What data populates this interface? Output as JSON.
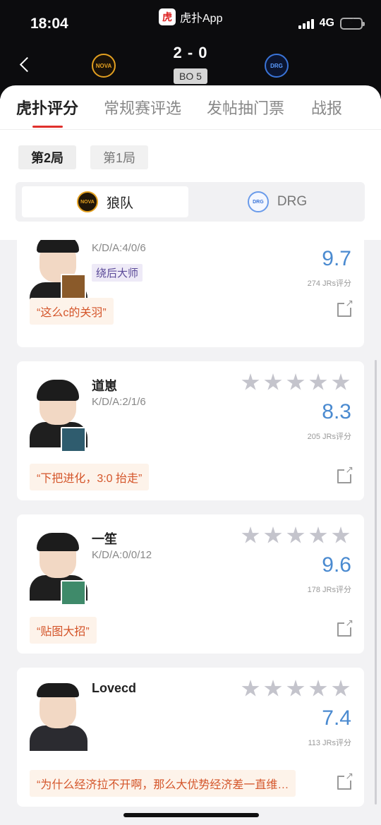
{
  "status_bar": {
    "time": "18:04",
    "app_label": "虎扑App",
    "network": "4G"
  },
  "header": {
    "score": "2 - 0",
    "bo": "BO 5",
    "team_left_logo": "NOVA",
    "team_right_logo": "DRG"
  },
  "tabs": [
    {
      "label": "虎扑评分",
      "active": true
    },
    {
      "label": "常规赛评选",
      "active": false
    },
    {
      "label": "发帖抽门票",
      "active": false
    },
    {
      "label": "战报",
      "active": false
    }
  ],
  "games": [
    {
      "label": "第2局",
      "active": true
    },
    {
      "label": "第1局",
      "active": false
    }
  ],
  "teams": [
    {
      "label": "狼队",
      "active": true
    },
    {
      "label": "DRG",
      "active": false
    }
  ],
  "players": [
    {
      "name": "",
      "kda": "K/D/A:4/0/6",
      "tag": "绕后大师",
      "score": "9.7",
      "count": "274 JRs评分",
      "quote": "“这么c的关羽”",
      "hero_color": "#8a5a2a"
    },
    {
      "name": "道崽",
      "kda": "K/D/A:2/1/6",
      "tag": "",
      "score": "8.3",
      "count": "205 JRs评分",
      "quote": "“下把进化，3:0 抬走”",
      "hero_color": "#2f5c6e"
    },
    {
      "name": "一笙",
      "kda": "K/D/A:0/0/12",
      "tag": "",
      "score": "9.6",
      "count": "178 JRs评分",
      "quote": "“贴图大招”",
      "hero_color": "#3f8a6a"
    },
    {
      "name": "Lovecd",
      "kda": "",
      "tag": "",
      "score": "7.4",
      "count": "113 JRs评分",
      "quote": "“为什么经济拉不开啊，那么大优势经济差一直维…",
      "hero_color": ""
    }
  ]
}
